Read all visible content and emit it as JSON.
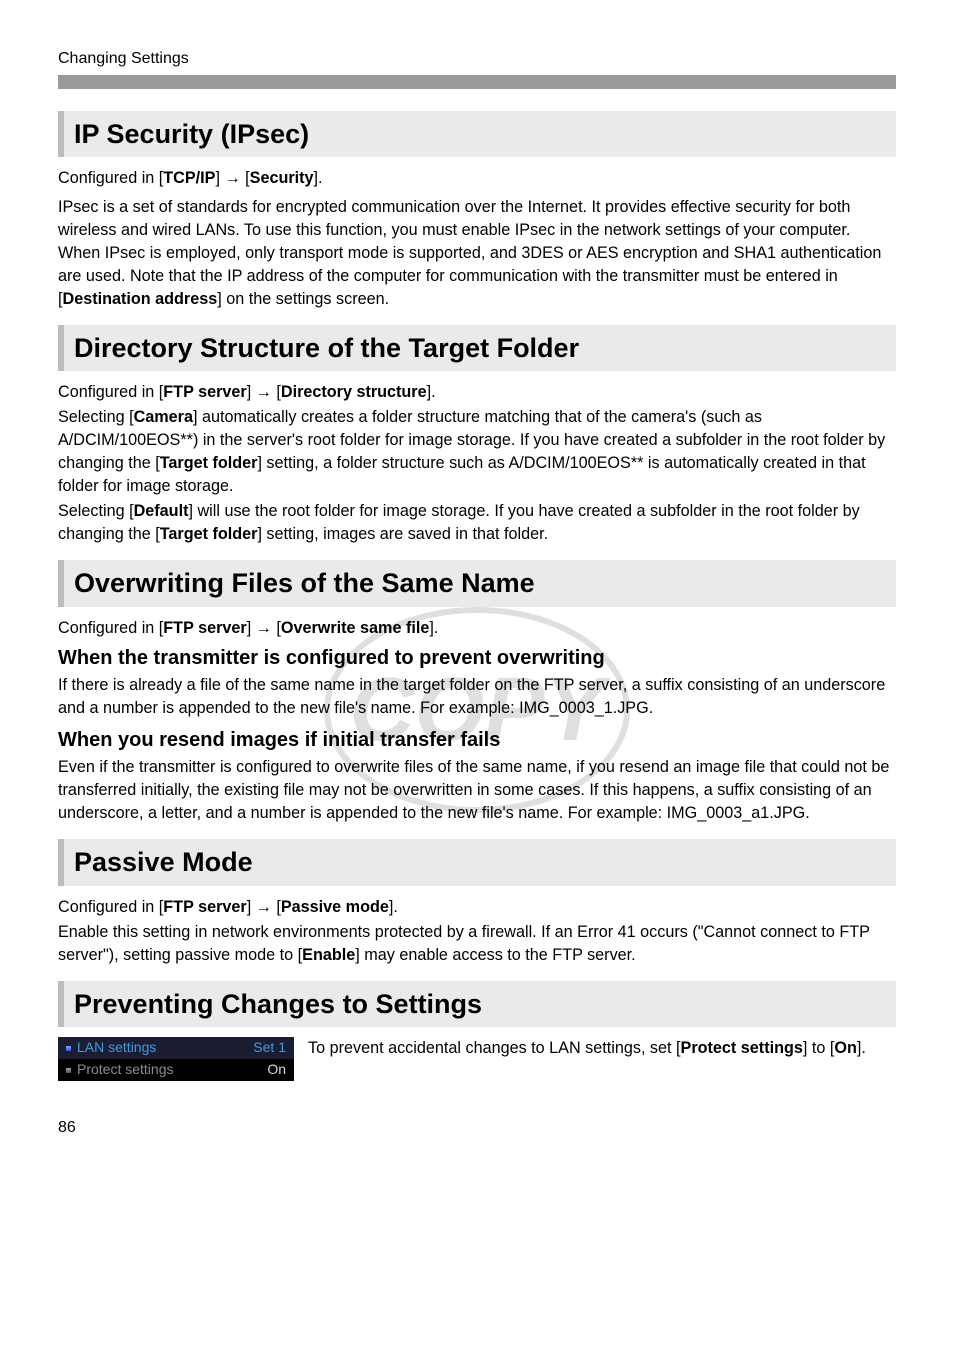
{
  "running_header": "Changing Settings",
  "ipsec": {
    "title": "IP Security (IPsec)",
    "configured_prefix": "Configured in [",
    "configured_a": "TCP/IP",
    "configured_mid": "] → [",
    "configured_b": "Security",
    "configured_suffix": "].",
    "body_a": "IPsec is a set of standards for encrypted communication over the Internet. It provides effective security for both wireless and wired LANs. To use this function, you must enable IPsec in the network settings of your computer. When IPsec is employed, only transport mode is supported, and 3DES or AES encryption and SHA1 authentication are used. Note that the IP address of the computer for communication with the transmitter must be entered in [",
    "body_a_bold": "Destination address",
    "body_a_tail": "] on the settings screen."
  },
  "dir": {
    "title": "Directory Structure of the Target Folder",
    "configured_prefix": "Configured in [",
    "configured_a": "FTP server",
    "configured_mid": "] → [",
    "configured_b": "Directory structure",
    "configured_suffix": "].",
    "p1_a": "Selecting [",
    "p1_bold1": "Camera",
    "p1_b": "] automatically creates a folder structure matching that of the camera's (such as A/DCIM/100EOS**) in the server's root folder for image storage. If you have created a subfolder in the root folder by changing the [",
    "p1_bold2": "Target folder",
    "p1_c": "] setting, a folder structure such as A/DCIM/100EOS** is automatically created in that folder for image storage.",
    "p2_a": "Selecting [",
    "p2_bold1": "Default",
    "p2_b": "] will use the root folder for image storage. If you have created a subfolder in the root folder by changing the [",
    "p2_bold2": "Target folder",
    "p2_c": "] setting, images are saved in that folder."
  },
  "ow": {
    "title": "Overwriting Files of the Same Name",
    "configured_prefix": "Configured in [",
    "configured_a": "FTP server",
    "configured_mid": "] → [",
    "configured_b": "Overwrite same file",
    "configured_suffix": "].",
    "sub1": "When the transmitter is configured to prevent overwriting",
    "sub1_body": "If there is already a file of the same name in the target folder on the FTP server, a suffix consisting of an underscore and a number is appended to the new file's name. For example: IMG_0003_1.JPG.",
    "sub2": "When you resend images if initial transfer fails",
    "sub2_body": "Even if the transmitter is configured to overwrite files of the same name, if you resend an image file that could not be transferred initially, the existing file may not be overwritten in some cases. If this happens, a suffix consisting of an underscore, a letter, and a number is appended to the new file's name. For example: IMG_0003_a1.JPG."
  },
  "passive": {
    "title": "Passive Mode",
    "configured_prefix": "Configured in [",
    "configured_a": "FTP server",
    "configured_mid": "] → [",
    "configured_b": "Passive mode",
    "configured_suffix": "].",
    "body_a": "Enable this setting in network environments protected by a firewall. If an Error 41 occurs (\"Cannot connect to FTP server\"), setting passive mode to [",
    "body_bold": "Enable",
    "body_b": "] may enable access to the FTP server."
  },
  "prevent": {
    "title": "Preventing Changes to Settings",
    "shot": {
      "row1_label": "LAN settings",
      "row1_value": "Set 1",
      "row2_label": "Protect settings",
      "row2_value": "On"
    },
    "body_a": "To prevent accidental changes to LAN settings, set [",
    "body_bold1": "Protect settings",
    "body_b": "] to [",
    "body_bold2": "On",
    "body_c": "]."
  },
  "watermark": "COPY",
  "page_number": "86"
}
